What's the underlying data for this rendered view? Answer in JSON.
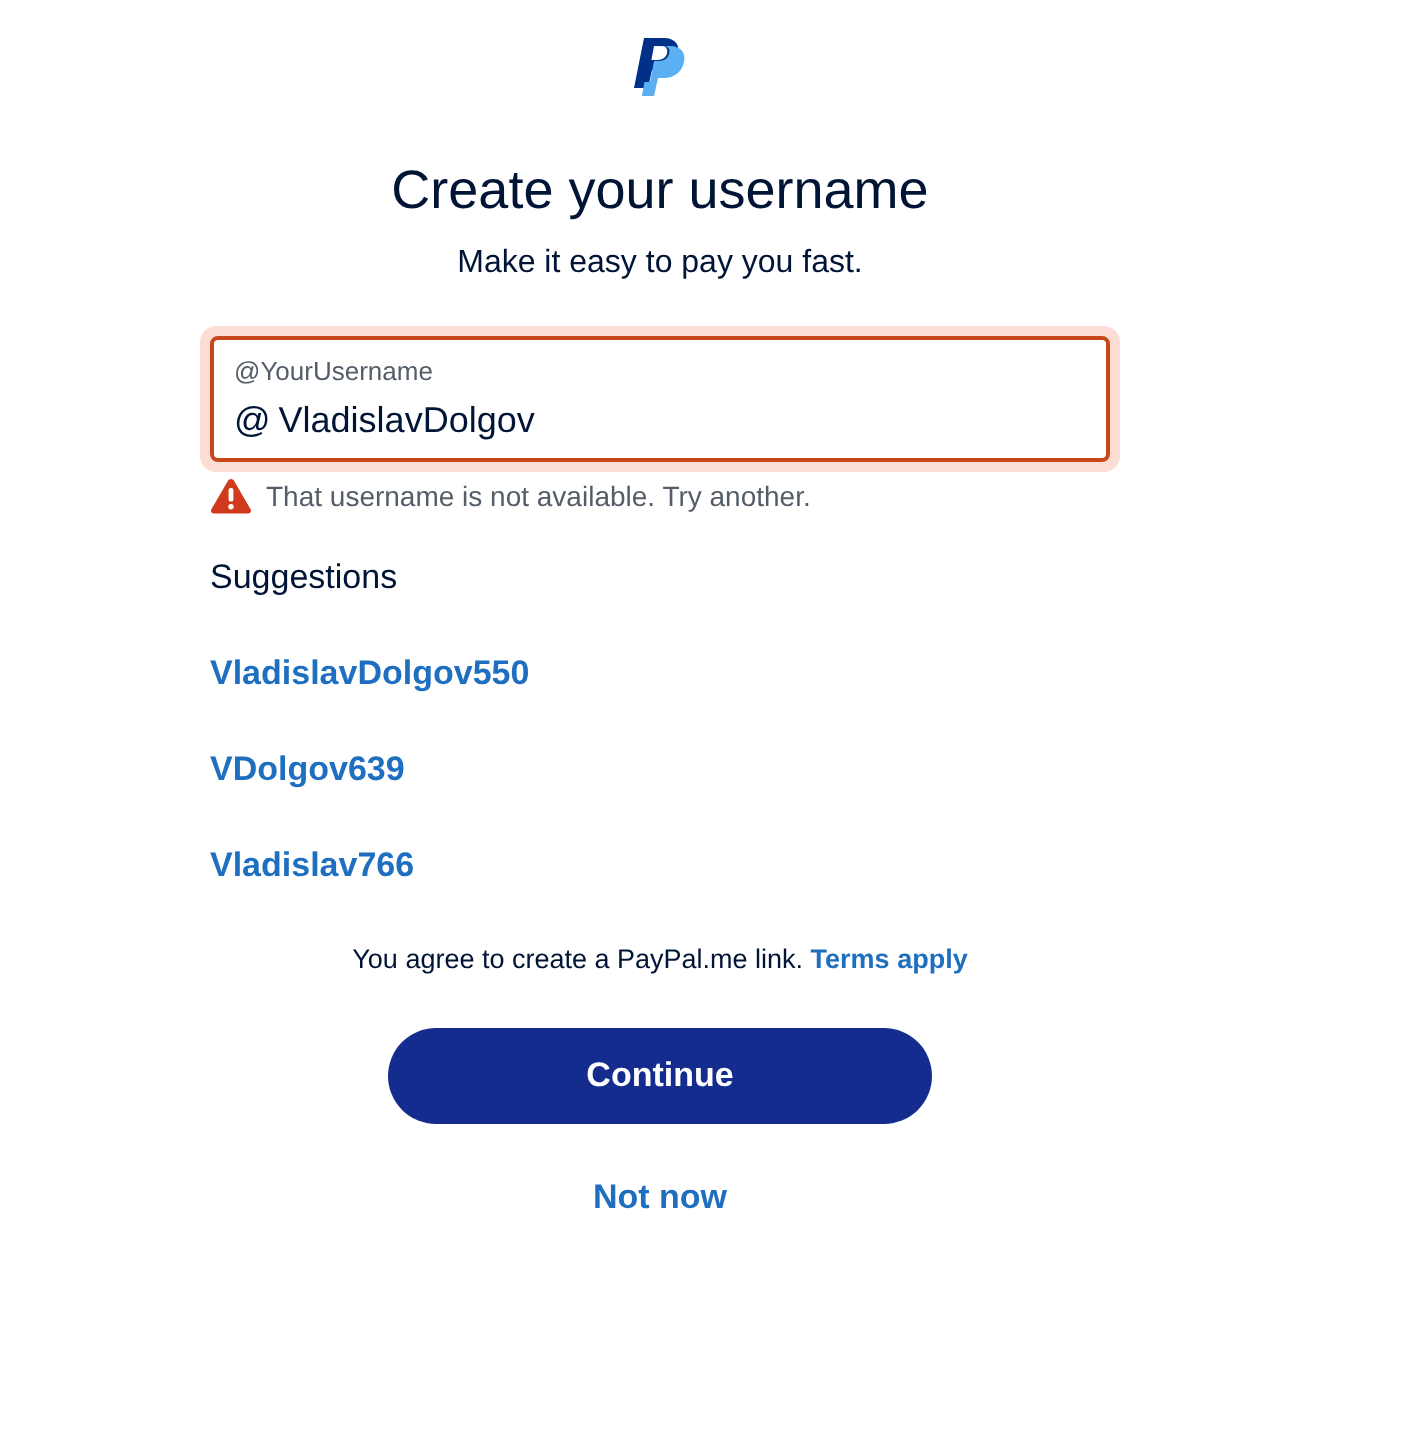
{
  "title": "Create your username",
  "subtitle": "Make it easy to pay you fast.",
  "username_field": {
    "label": "@YourUsername",
    "prefix": "@",
    "value": "VladislavDolgov",
    "invalid": true
  },
  "error_message": "That username is not available. Try another.",
  "suggestions": {
    "heading": "Suggestions",
    "items": [
      "VladislavDolgov550",
      "VDolgov639",
      "Vladislav766"
    ]
  },
  "agreement": {
    "text": "You agree to create a PayPal.me link.",
    "link": "Terms apply"
  },
  "buttons": [
    {
      "kind": "primary",
      "label": "Continue"
    },
    {
      "kind": "link",
      "label": "Not now"
    }
  ]
}
